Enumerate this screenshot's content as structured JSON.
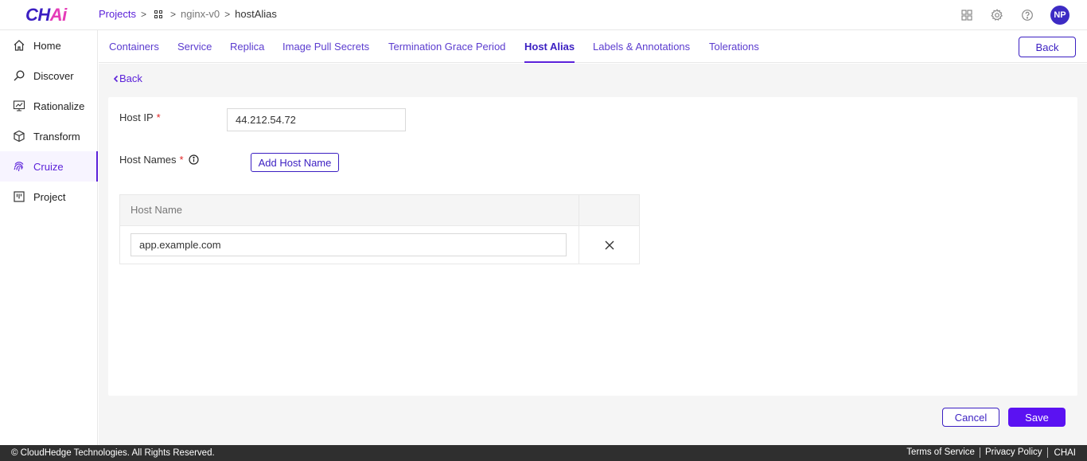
{
  "app": {
    "logo_main": "CH",
    "logo_accent": "Ai"
  },
  "breadcrumb": {
    "projects": "Projects",
    "app": "nginx-v0",
    "current": "hostAlias"
  },
  "header": {
    "avatar_initials": "NP"
  },
  "sidebar": {
    "items": [
      {
        "label": "Home",
        "icon": "home-icon"
      },
      {
        "label": "Discover",
        "icon": "search-icon"
      },
      {
        "label": "Rationalize",
        "icon": "chart-icon"
      },
      {
        "label": "Transform",
        "icon": "cube-icon"
      },
      {
        "label": "Cruize",
        "icon": "fingerprint-icon",
        "active": true
      },
      {
        "label": "Project",
        "icon": "board-icon"
      }
    ]
  },
  "tabs": {
    "items": [
      "Containers",
      "Service",
      "Replica",
      "Image Pull Secrets",
      "Termination Grace Period",
      "Host Alias",
      "Labels & Annotations",
      "Tolerations"
    ],
    "active": "Host Alias",
    "back_button": "Back"
  },
  "main": {
    "back_link": "Back",
    "host_ip": {
      "label": "Host IP",
      "required": "*",
      "value": "44.212.54.72"
    },
    "host_names": {
      "label": "Host Names",
      "required": "*",
      "add_button": "Add Host Name"
    },
    "table": {
      "columns": [
        "Host Name",
        ""
      ],
      "rows": [
        {
          "host_name": "app.example.com"
        }
      ]
    },
    "cancel": "Cancel",
    "save": "Save"
  },
  "footer": {
    "copyright": "© CloudHedge Technologies. All Rights Reserved.",
    "links": [
      "Terms of Service",
      "Privacy Policy"
    ],
    "brand": "CHAI"
  },
  "colors": {
    "accent": "#5b21d9",
    "primary_button": "#5b12f2",
    "footer_bg": "#2f2f2f",
    "required": "#e02424"
  }
}
